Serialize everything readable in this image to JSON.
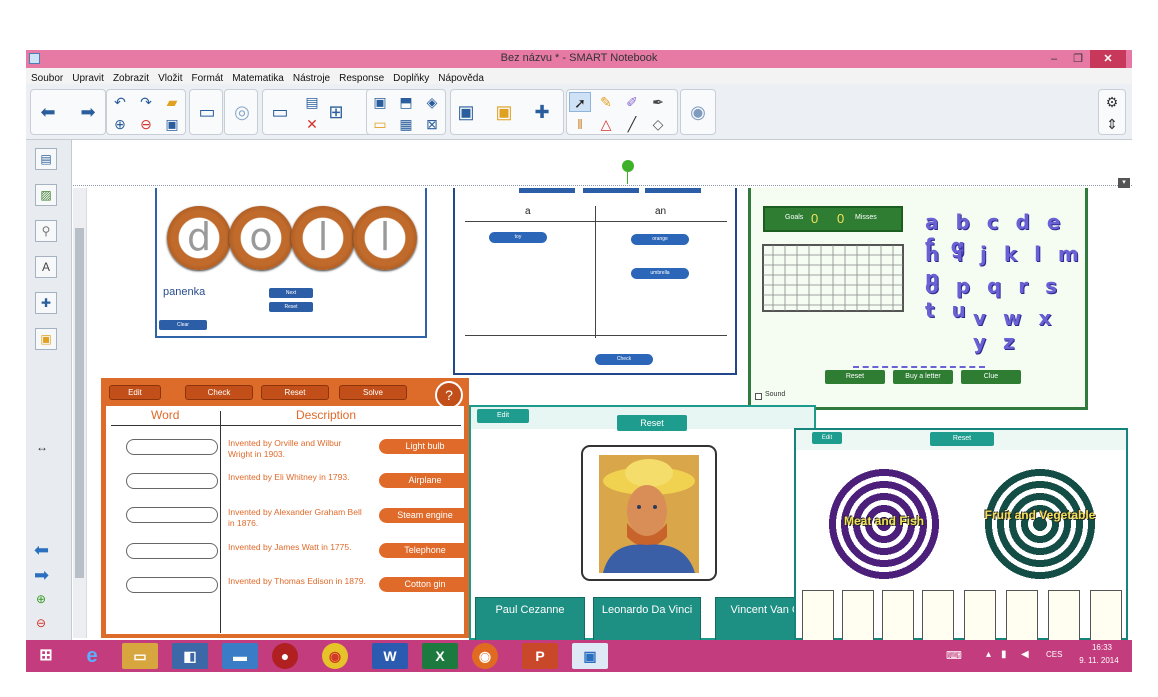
{
  "window": {
    "title": "Bez názvu * - SMART Notebook",
    "minimize": "–",
    "restore": "❐",
    "close": "✕"
  },
  "menu": [
    "Soubor",
    "Upravit",
    "Zobrazit",
    "Vložit",
    "Formát",
    "Matematika",
    "Nástroje",
    "Response",
    "Doplňky",
    "Nápověda"
  ],
  "sidebar": {
    "resize_glyph": "↔"
  },
  "doll": {
    "letters": [
      "d",
      "o",
      "l",
      "l"
    ],
    "word": "panenka",
    "btn1": "Next",
    "btn2": "Reset",
    "btn3": "Clear"
  },
  "sort": {
    "col_a": "a",
    "col_an": "an",
    "item1": "toy",
    "item2": "orange",
    "item3": "umbrella",
    "check": "Check"
  },
  "soccer": {
    "goals_label": "Goals",
    "goals": "0",
    "misses": "0",
    "misses_label": "Misses",
    "letters": [
      "a b c d e f g",
      "h i j k l m n",
      "o p q r s t u",
      "v w x y z"
    ],
    "btn_reset": "Reset",
    "btn_letter": "Buy a letter",
    "btn_clue": "Clue",
    "sound": "Sound"
  },
  "inventors": {
    "buttons": [
      "Edit",
      "Check",
      "Reset",
      "Solve"
    ],
    "help": "?",
    "col_word": "Word",
    "col_desc": "Description",
    "rows": [
      {
        "desc": "Invented by Orville and Wilbur Wright in 1903.",
        "answer": "Light bulb"
      },
      {
        "desc": "Invented by Eli Whitney in 1793.",
        "answer": "Airplane"
      },
      {
        "desc": "Invented by Alexander Graham Bell in 1876.",
        "answer": "Steam engine"
      },
      {
        "desc": "Invented by James Watt in 1775.",
        "answer": "Telephone"
      },
      {
        "desc": "Invented by Thomas Edison in 1879.",
        "answer": "Cotton gin"
      }
    ]
  },
  "artist": {
    "edit": "Edit",
    "reset": "Reset",
    "choices": [
      "Paul Cezanne",
      "Leonardo Da Vinci",
      "Vincent Van G"
    ]
  },
  "spirals": {
    "btn1": "Edit",
    "btn2": "Reset",
    "label1": "Meat and Fish",
    "label2": "Fruit and Vegetable"
  },
  "taskbar": {
    "lang": "CES",
    "time": "16:33",
    "date": "9. 11. 2014"
  },
  "colors": {
    "title_bar": "#e67aa5",
    "taskbar": "#c33d7e",
    "accent_orange": "#dd6b2a",
    "accent_teal": "#1e9c8e",
    "accent_green": "#2f7a3c"
  }
}
